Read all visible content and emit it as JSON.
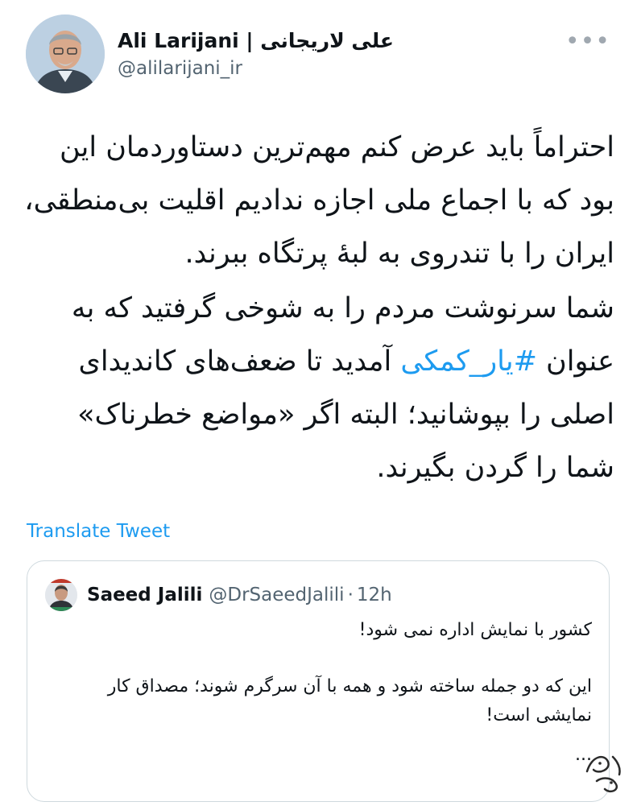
{
  "author": {
    "display_name": "Ali Larijani | علی لاریجانی",
    "handle": "@alilarijani_ir"
  },
  "more_icon": "more-horizontal-icon",
  "tweet": {
    "paragraph_1": "احتراماً باید عرض کنم مهم‌ترین دستاوردمان این بود که با اجماع ملی اجازه ندادیم اقلیت بی‌منطقی، ایران را با تندروی به لبهٔ پرتگاه ببرند.",
    "paragraph_2_before": "شما سرنوشت مردم را به شوخی گرفتید که به عنوان ",
    "hashtag": "#یار_کمکی",
    "paragraph_2_after": " آمدید تا ضعف‌های کاندیدای اصلی را بپوشانید؛ البته اگر «مواضع خطرناک» شما را گردن بگیرند."
  },
  "translate_label": "Translate Tweet",
  "quoted": {
    "display_name": "Saeed Jalili",
    "handle": "@DrSaeedJalili",
    "separator": "·",
    "time": "12h",
    "paragraph_1": "کشور با نمایش اداره نمی شود!",
    "paragraph_2": "این که دو جمله ساخته شود و همه با آن سرگرم شوند؛ مصداق کار نمایشی است!",
    "ellipsis": "..."
  },
  "colors": {
    "accent": "#1d9bf0",
    "text": "#0f1419",
    "secondary": "#536471",
    "border": "#cfd9de"
  }
}
